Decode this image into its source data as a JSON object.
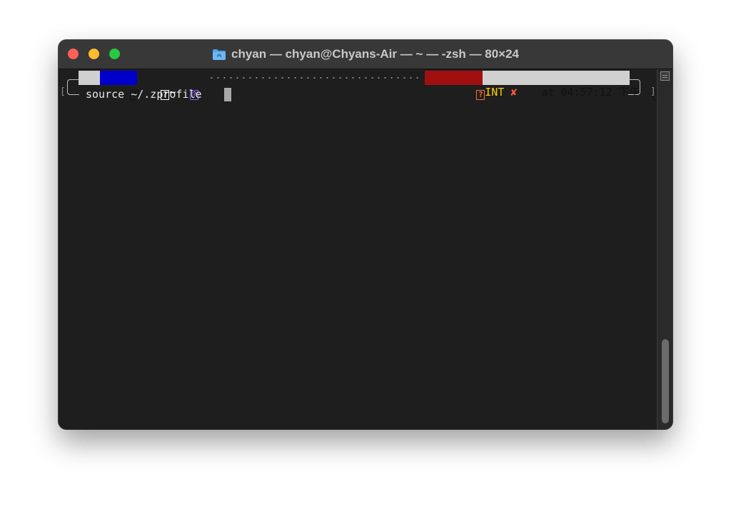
{
  "window": {
    "title": "chyan — chyan@Chyans-Air — ~ — -zsh — 80×24",
    "traffic_lights": {
      "close_color": "#ff5f57",
      "minimize_color": "#febc2e",
      "zoom_color": "#28c840"
    },
    "title_icon": "home-folder-icon"
  },
  "prompt": {
    "left": {
      "os_glyph": "?",
      "dir_glyph": "?",
      "dir": "~",
      "vcs_glyph": "?"
    },
    "right": {
      "status_glyph": "?",
      "status": "INT",
      "status_mark": "✘",
      "time_prefix": "at",
      "time": "04:57:12 下午",
      "time_glyph": "?"
    },
    "open_bracket": "[",
    "close_bracket": "]"
  },
  "command": {
    "text": "source ~/.zprofile"
  },
  "colors": {
    "terminal_bg": "#1e1e1e",
    "dir_segment_bg": "#0000cc",
    "status_segment_bg": "#b01515",
    "status_text": "#ffd700",
    "time_segment_bg": "#d0d0d0",
    "vcs_glyph_color": "#8a5cf0"
  }
}
